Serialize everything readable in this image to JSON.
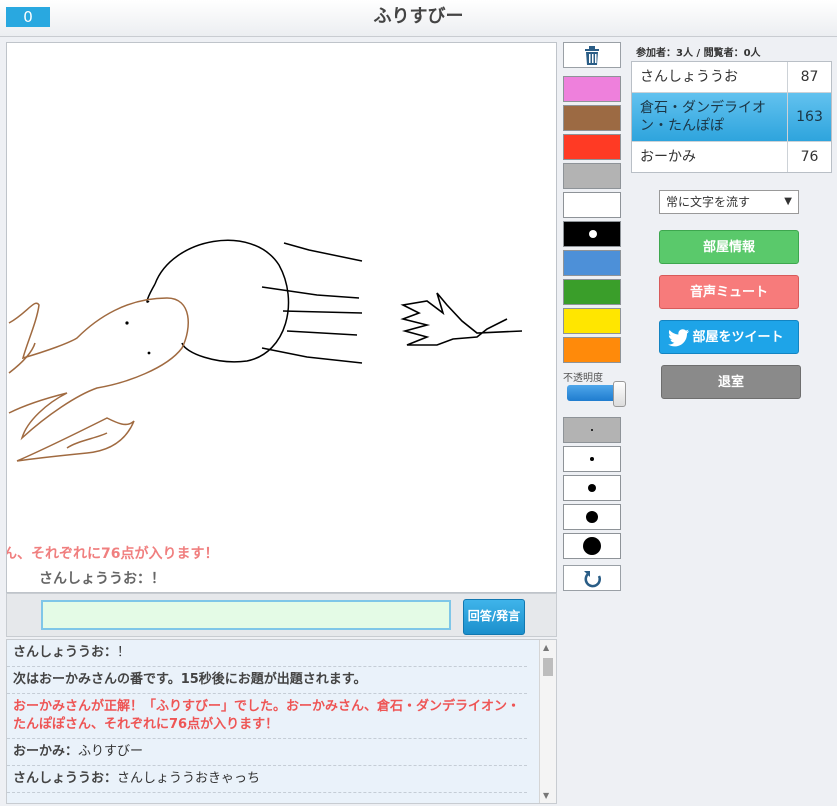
{
  "header": {
    "timer": "0",
    "title": "ふりすびー"
  },
  "canvas": {
    "flash_message": "ん、それぞれに76点が入ります！",
    "flash_speaker": "さんしょううお：！"
  },
  "answer": {
    "value": "",
    "button_label": "回答/発言"
  },
  "log": [
    {
      "type": "user",
      "name": "さんしょううお",
      "sep": "：",
      "text": "！"
    },
    {
      "type": "sys",
      "text": "次はおーかみさんの番です。15秒後にお題が出題されます。"
    },
    {
      "type": "red",
      "text": "おーかみさんが正解！「ふりすびー」でした。おーかみさん、倉石・ダンデライオン・たんぽぽさん、それぞれに76点が入ります！"
    },
    {
      "type": "user",
      "name": "おーかみ",
      "sep": "：",
      "text": "ふりすびー"
    },
    {
      "type": "user",
      "name": "さんしょううお",
      "sep": "：",
      "text": "さんしょううおきゃっち"
    }
  ],
  "tools": {
    "trash_icon": "trash-icon",
    "colors": [
      "#ee80dc",
      "#9c6a43",
      "#ff3a24",
      "#b3b3b3",
      "#ffffff",
      "#000000",
      "#4d90d8",
      "#3a9e2a",
      "#ffe600",
      "#ff8a0a"
    ],
    "opacity_label": "不透明度",
    "opacity_value": 1.0,
    "pen_sizes": [
      2,
      4,
      8,
      12,
      18
    ],
    "undo_icon": "undo-icon"
  },
  "players": {
    "label": "参加者：3人 / 閲覧者：0人",
    "list": [
      {
        "name": "さんしょううお",
        "score": "87",
        "active": false
      },
      {
        "name": "倉石・ダンデライオン・たんぽぽ",
        "score": "163",
        "active": true
      },
      {
        "name": "おーかみ",
        "score": "76",
        "active": false
      }
    ]
  },
  "options": {
    "scroll_mode": "常に文字を流す"
  },
  "buttons": {
    "room_info": "部屋情報",
    "mute": "音声ミュート",
    "tweet": "部屋をツイート",
    "exit": "退室"
  }
}
